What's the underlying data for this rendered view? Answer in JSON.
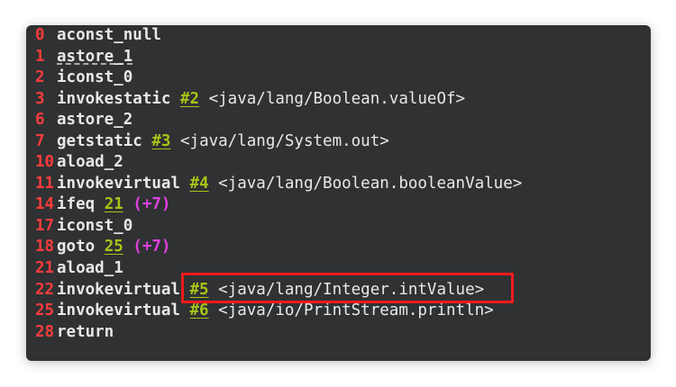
{
  "lines": [
    {
      "offset": "0",
      "instr": "aconst_null",
      "ref": "",
      "member": "",
      "delta": ""
    },
    {
      "offset": "1",
      "instr": "astore_1",
      "ref": "",
      "member": "",
      "delta": ""
    },
    {
      "offset": "2",
      "instr": "iconst_0",
      "ref": "",
      "member": "",
      "delta": ""
    },
    {
      "offset": "3",
      "instr": "invokestatic",
      "ref": "#2",
      "member": "<java/lang/Boolean.valueOf>",
      "delta": ""
    },
    {
      "offset": "6",
      "instr": "astore_2",
      "ref": "",
      "member": "",
      "delta": ""
    },
    {
      "offset": "7",
      "instr": "getstatic",
      "ref": "#3",
      "member": "<java/lang/System.out>",
      "delta": ""
    },
    {
      "offset": "10",
      "instr": "aload_2",
      "ref": "",
      "member": "",
      "delta": ""
    },
    {
      "offset": "11",
      "instr": "invokevirtual",
      "ref": "#4",
      "member": "<java/lang/Boolean.booleanValue>",
      "delta": ""
    },
    {
      "offset": "14",
      "instr": "ifeq",
      "ref": "21",
      "member": "",
      "delta": "(+7)"
    },
    {
      "offset": "17",
      "instr": "iconst_0",
      "ref": "",
      "member": "",
      "delta": ""
    },
    {
      "offset": "18",
      "instr": "goto",
      "ref": "25",
      "member": "",
      "delta": "(+7)"
    },
    {
      "offset": "21",
      "instr": "aload_1",
      "ref": "",
      "member": "",
      "delta": ""
    },
    {
      "offset": "22",
      "instr": "invokevirtual",
      "ref": "#5",
      "member": "<java/lang/Integer.intValue>",
      "delta": ""
    },
    {
      "offset": "25",
      "instr": "invokevirtual",
      "ref": "#6",
      "member": "<java/io/PrintStream.println>",
      "delta": ""
    },
    {
      "offset": "28",
      "instr": "return",
      "ref": "",
      "member": "",
      "delta": ""
    }
  ],
  "colors": {
    "background": "#2f3133",
    "offset": "#ff3c3c",
    "reference": "#a8c418",
    "jump_delta": "#e040e0",
    "highlight": "#ee1c1c"
  }
}
